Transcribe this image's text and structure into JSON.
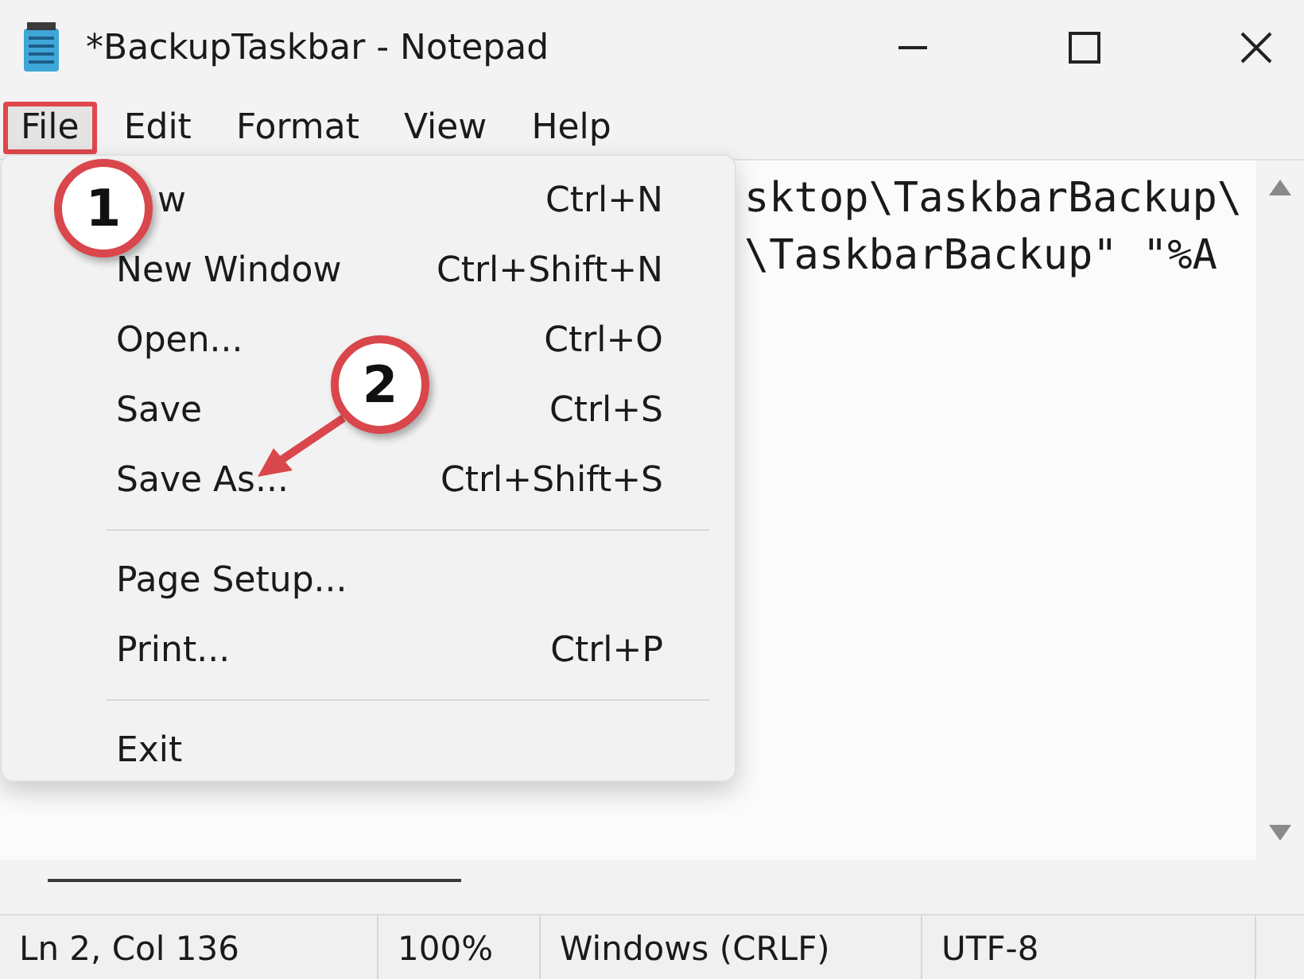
{
  "window": {
    "title": "*BackupTaskbar - Notepad"
  },
  "menu_bar": [
    {
      "label": "File",
      "selected": true,
      "highlighted": true
    },
    {
      "label": "Edit",
      "selected": false,
      "highlighted": false
    },
    {
      "label": "Format",
      "selected": false,
      "highlighted": false
    },
    {
      "label": "View",
      "selected": false,
      "highlighted": false
    },
    {
      "label": "Help",
      "selected": false,
      "highlighted": false
    }
  ],
  "file_menu": {
    "items": [
      {
        "kind": "item",
        "label": "w",
        "shortcut": "Ctrl+N"
      },
      {
        "kind": "item",
        "label": "New Window",
        "shortcut": "Ctrl+Shift+N"
      },
      {
        "kind": "item",
        "label": "Open...",
        "shortcut": "Ctrl+O"
      },
      {
        "kind": "item",
        "label": "Save",
        "shortcut": "Ctrl+S"
      },
      {
        "kind": "item",
        "label": "Save As...",
        "shortcut": "Ctrl+Shift+S"
      },
      {
        "kind": "separator"
      },
      {
        "kind": "item",
        "label": "Page Setup..."
      },
      {
        "kind": "item",
        "label": "Print...",
        "shortcut": "Ctrl+P"
      },
      {
        "kind": "separator"
      },
      {
        "kind": "item",
        "label": "Exit"
      }
    ]
  },
  "editor": {
    "lines": [
      "sktop\\TaskbarBackup\\",
      "\\TaskbarBackup\" \"%A"
    ]
  },
  "status_bar": [
    "Ln 2, Col 136",
    "100%",
    "Windows (CRLF)",
    "UTF-8"
  ],
  "callouts": [
    {
      "kind": "badge",
      "number": "1"
    },
    {
      "kind": "badge-arrow",
      "number": "2"
    }
  ]
}
